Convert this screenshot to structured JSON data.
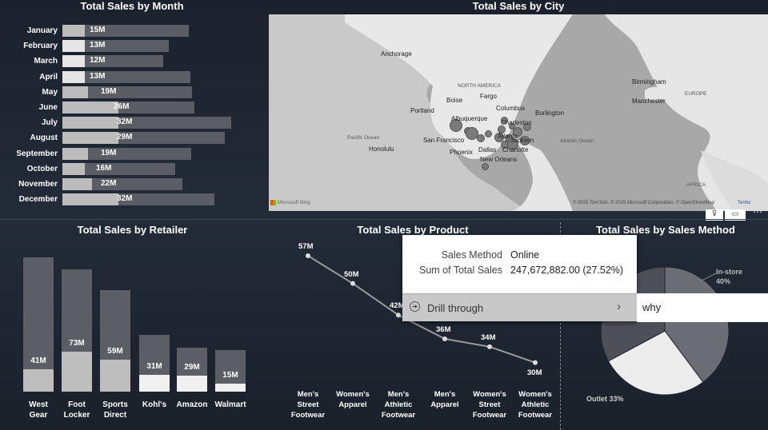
{
  "month_chart": {
    "title": "Total Sales by Month",
    "chart_data": {
      "type": "bar",
      "title": "Total Sales by Month",
      "categories": [
        "January",
        "February",
        "March",
        "April",
        "May",
        "June",
        "July",
        "August",
        "September",
        "October",
        "November",
        "December"
      ],
      "labels": [
        "15M",
        "13M",
        "12M",
        "13M",
        "19M",
        "26M",
        "32M",
        "29M",
        "19M",
        "16M",
        "22M",
        "32M"
      ],
      "values": [
        15,
        13,
        12,
        13,
        19,
        26,
        32,
        29,
        19,
        16,
        22,
        32
      ]
    }
  },
  "city_map": {
    "title": "Total Sales by City",
    "places": [
      "Anchorage",
      "NORTH AMERICA",
      "Fargo",
      "Boise",
      "Columbus",
      "Burlington",
      "Portland",
      "Albuquerque",
      "Charleston",
      "Pacific Ocean",
      "Honolulu",
      "San Francisco",
      "Atlanta",
      "Jackson",
      "Dallas",
      "Charlotte",
      "Phoenix",
      "New Orleans",
      "Atlantic Ocean",
      "Birmingham",
      "Manchester",
      "EUROPE",
      "AFRICA"
    ],
    "attribution": "© 2025 TomTom, © 2025 Microsoft Corporation, © OpenStreetMap",
    "terms": "Terms",
    "logo_text": "Microsoft Bing"
  },
  "retailer_chart": {
    "title": "Total Sales by Retailer",
    "chart_data": {
      "type": "bar",
      "title": "Total Sales by Retailer",
      "categories": [
        "West Gear",
        "Foot Locker",
        "Sports Direct",
        "Kohl's",
        "Amazon",
        "Walmart"
      ],
      "labels": [
        "41M",
        "73M",
        "59M",
        "31M",
        "29M",
        "15M"
      ],
      "values": [
        41,
        73,
        59,
        31,
        29,
        15
      ]
    }
  },
  "product_chart": {
    "title": "Total Sales by Product",
    "chart_data": {
      "type": "line",
      "title": "Total Sales by Product",
      "categories": [
        "Men's Street Footwear",
        "Women's Apparel",
        "Men's Athletic Footwear",
        "Men's Apparel",
        "Women's Street Footwear",
        "Women's Athletic Footwear"
      ],
      "category_lines": [
        [
          "Men's",
          "Street",
          "Footwear"
        ],
        [
          "Women's",
          "Apparel"
        ],
        [
          "Men's",
          "Athletic",
          "Footwear"
        ],
        [
          "Men's",
          "Apparel"
        ],
        [
          "Women's",
          "Street",
          "Footwear"
        ],
        [
          "Women's",
          "Athletic",
          "Footwear"
        ]
      ],
      "labels": [
        "57M",
        "50M",
        "42M",
        "36M",
        "34M",
        "30M"
      ],
      "values": [
        57,
        50,
        42,
        36,
        34,
        30
      ]
    }
  },
  "method_chart": {
    "title": "Total Sales by Sales Method",
    "chart_data": {
      "type": "pie",
      "title": "Total Sales by Sales Method",
      "slices": [
        {
          "name": "In-store",
          "label": "40%",
          "value": 40
        },
        {
          "name": "Online",
          "value": 27.52
        },
        {
          "name": "Outlet",
          "label": "33%",
          "value": 33
        }
      ]
    },
    "instore_label": "In-store",
    "instore_pct": "40%",
    "outlet_label": "Outlet 33%"
  },
  "tooltip": {
    "key1": "Sales Method",
    "val1": "Online",
    "key2": "Sum of Total Sales",
    "val2": "247,672,882.00 (27.52%)",
    "drill_label": "Drill through",
    "submenu_item": "why"
  },
  "colors": {
    "bar_bg": "#5a5d63",
    "bar_fg": "#bcbcbc",
    "background": "#1d2430"
  }
}
